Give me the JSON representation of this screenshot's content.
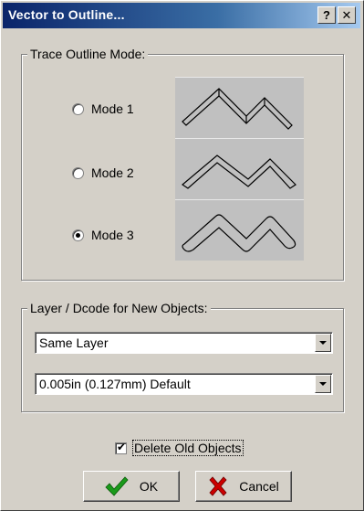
{
  "window": {
    "title": "Vector to Outline...",
    "help_label": "?",
    "close_label": "✕"
  },
  "trace": {
    "legend": "Trace Outline Mode:",
    "modes": [
      {
        "label": "Mode 1",
        "selected": false
      },
      {
        "label": "Mode 2",
        "selected": false
      },
      {
        "label": "Mode 3",
        "selected": true
      }
    ]
  },
  "layer": {
    "legend": "Layer / Dcode for New Objects:",
    "layer_value": "Same Layer",
    "dcode_value": "0.005in (0.127mm) Default"
  },
  "options": {
    "delete_old_label": "Delete Old Objects",
    "delete_old_checked": true
  },
  "buttons": {
    "ok_label": "OK",
    "cancel_label": "Cancel"
  },
  "colors": {
    "title_gradient_start": "#0a246a",
    "ok_icon": "#1a9a1a",
    "cancel_icon": "#cc0000",
    "preview_bg": "#c0c0c0"
  }
}
